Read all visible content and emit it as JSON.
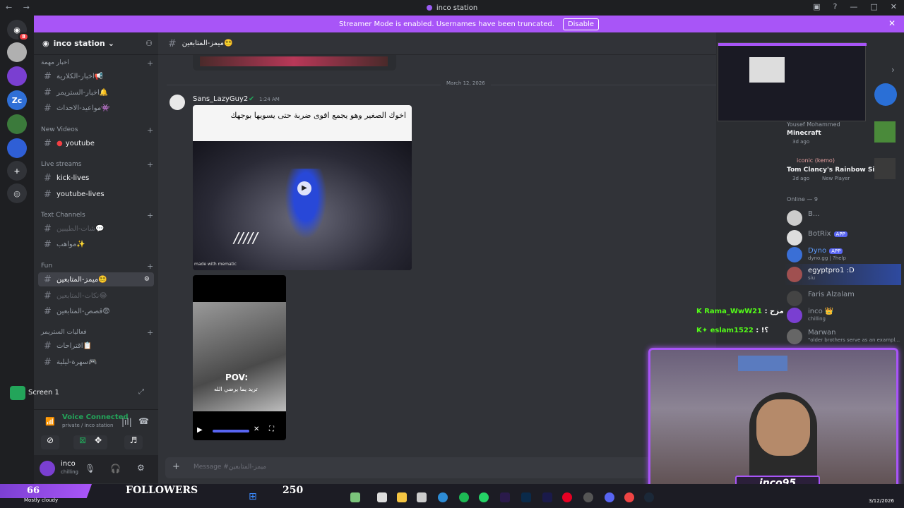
{
  "window": {
    "title": "inco station"
  },
  "banner": {
    "text": "Streamer Mode is enabled. Usernames have been truncated.",
    "button": "Disable"
  },
  "rail": {
    "badge1": "8",
    "zc_label": "Zc"
  },
  "server": {
    "name": "inco station"
  },
  "categories": {
    "news": "اخبار مهمة",
    "new_videos": "New Videos",
    "live_streams": "Live streams",
    "text_channels": "Text Channels",
    "fun": "Fun",
    "streamer_activities": "فعاليات الستريمر"
  },
  "channels": {
    "news_1": "اخبار-الكلارية📢",
    "news_2": "اخبار-الستريمر🔔",
    "news_3": "مواعيد-الاحداث👾",
    "youtube": "youtube",
    "kick_lives": "kick-lives",
    "youtube_lives": "youtube-lives",
    "text_1": "شات-الطيبين💬",
    "text_2": "مواهب✨",
    "fun_1": "ميمز-المتابعين😵‍💫",
    "fun_2": "نكات-المتابعين😂",
    "fun_3": "قصص-المتابعين😨",
    "act_1": "اقتراحات📋",
    "act_2": "سهرة-ليلية🎮"
  },
  "screen_panel": {
    "label": "Screen 1"
  },
  "voice": {
    "status": "Voice Connected",
    "location": "private / inco station"
  },
  "user": {
    "name": "inco",
    "status": "chilling"
  },
  "chat": {
    "header_channel": "ميمز-المتابعين😵‍💫",
    "date_divider": "March 12, 2026",
    "author": "Sans_LazyGuy2",
    "time": "1:24 AM",
    "meme_caption": "اخوك الصغير وهو يجمع اقوى ضربة حتى يسويها بوجهك",
    "meme_watermark": "made with mematic",
    "video_caption_pov": "POV:",
    "video_caption_ar": "تريد يما يرضي الله",
    "input_placeholder": "Message #ميمز-المتابعين"
  },
  "members": {
    "activity_1": {
      "user": "Yousef Mohammed",
      "game": "Minecraft",
      "time": "3d ago"
    },
    "activity_2": {
      "user": "iconic (kemo)",
      "game": "Tom Clancy's Rainbow Six ...",
      "time": "3d ago",
      "tag": "New Player"
    },
    "online_header": "Online — 9",
    "list": [
      {
        "name": "B...",
        "sub": ""
      },
      {
        "name": "BotRix",
        "sub": "",
        "tag": "APP"
      },
      {
        "name": "Dyno",
        "sub": "dyno.gg | ?help",
        "tag": "APP"
      },
      {
        "name": "egyptpro1 :D",
        "sub": "siu"
      },
      {
        "name": "Faris Alzalam",
        "sub": ""
      },
      {
        "name": "inco 👑",
        "sub": "chilling"
      },
      {
        "name": "Marwan",
        "sub": "\"older brothers serve as an exampl..."
      }
    ]
  },
  "stream_overlay": {
    "chat_1_user": "Rama_WwW21",
    "chat_1_msg": "مزح",
    "chat_2_user": "eslam1522",
    "chat_2_msg": "!؟",
    "cam_name": "inco95"
  },
  "taskbar": {
    "viewers": "66",
    "weather": "Mostly cloudy",
    "followers_label": "FOLLOWERS",
    "followers_count": "250",
    "date": "3/12/2026"
  },
  "colors": {
    "accent": "#a855f7",
    "discord_bg": "#313338",
    "sidebar": "#2b2d31",
    "online": "#23a55a"
  }
}
